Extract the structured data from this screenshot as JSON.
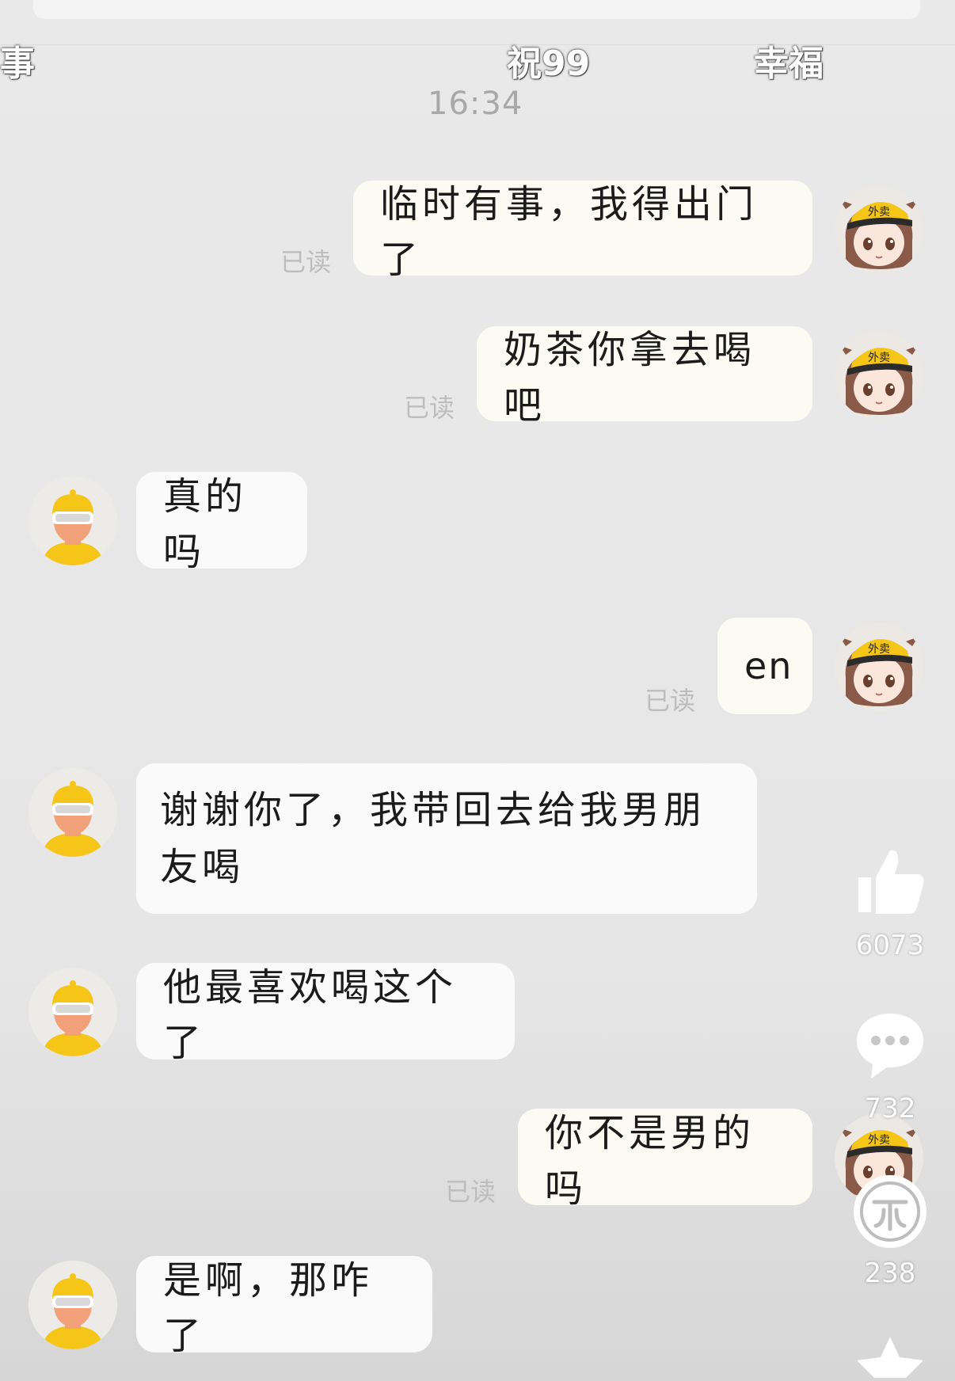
{
  "overlay": {
    "marquee_left": "事",
    "marquee_mid": "祝99",
    "marquee_right": "幸福"
  },
  "chat": {
    "timestamp": "16:34",
    "read_label": "已读",
    "messages": [
      {
        "side": "right",
        "text": "临时有事，我得出门了",
        "read": true
      },
      {
        "side": "right",
        "text": "奶茶你拿去喝吧",
        "read": true
      },
      {
        "side": "left",
        "text": "真的吗"
      },
      {
        "side": "right",
        "text": "en",
        "read": true
      },
      {
        "side": "left",
        "text": "谢谢你了，我带回去给我男朋友喝"
      },
      {
        "side": "left",
        "text": "他最喜欢喝这个了"
      },
      {
        "side": "right",
        "text": "你不是男的吗",
        "read": true
      },
      {
        "side": "left",
        "text": "是啊，那咋了"
      }
    ],
    "avatars": {
      "self": "delivery-girl-avatar",
      "other": "yellow-cap-avatar",
      "cap_text": "外卖"
    }
  },
  "actions": {
    "like_count": "6073",
    "comment_count": "732",
    "share_count": "238"
  },
  "colors": {
    "bubble_out": "#fbfbf3",
    "bubble_in": "#fafafa",
    "accent_yellow": "#f5c518"
  }
}
